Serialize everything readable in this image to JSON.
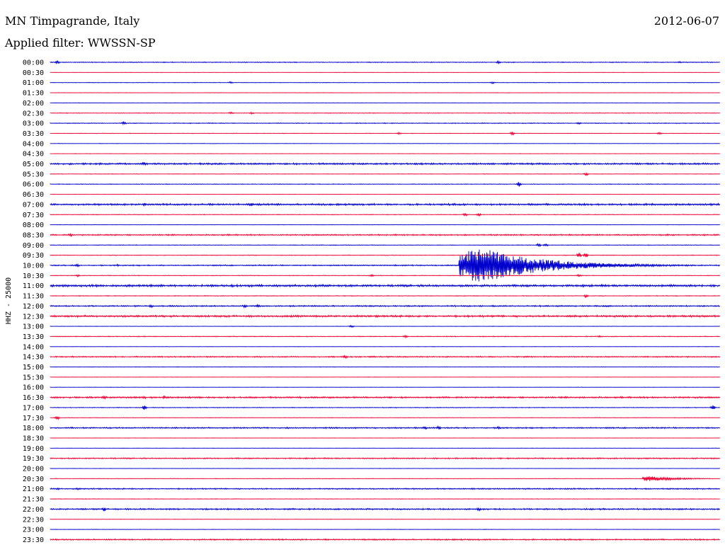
{
  "header": {
    "station": "MN Timpagrande, Italy",
    "filter": "Applied filter: WWSSN-SP",
    "date": "2012-06-07"
  },
  "chart_data": {
    "type": "line",
    "ylabel": "HHZ - 25000",
    "xlabel": "",
    "title": "",
    "trace_colors": [
      "#0000cc",
      "#ee0033"
    ],
    "series": [
      {
        "label": "00:00",
        "color": "#0000cc",
        "noise": 0.6,
        "spikes": [
          [
            0.01,
            2
          ],
          [
            0.67,
            2
          ],
          [
            0.94,
            1
          ]
        ]
      },
      {
        "label": "00:30",
        "color": "#ee0033",
        "noise": 0.3,
        "spikes": []
      },
      {
        "label": "01:00",
        "color": "#0000cc",
        "noise": 0.4,
        "spikes": [
          [
            0.27,
            1
          ],
          [
            0.66,
            1
          ]
        ]
      },
      {
        "label": "01:30",
        "color": "#ee0033",
        "noise": 0.3,
        "spikes": []
      },
      {
        "label": "02:00",
        "color": "#0000cc",
        "noise": 0.3,
        "spikes": []
      },
      {
        "label": "02:30",
        "color": "#ee0033",
        "noise": 0.5,
        "spikes": [
          [
            0.27,
            1
          ],
          [
            0.3,
            1
          ]
        ]
      },
      {
        "label": "03:00",
        "color": "#0000cc",
        "noise": 0.6,
        "spikes": [
          [
            0.11,
            2
          ],
          [
            0.79,
            1
          ]
        ]
      },
      {
        "label": "03:30",
        "color": "#ee0033",
        "noise": 0.4,
        "spikes": [
          [
            0.52,
            1
          ],
          [
            0.69,
            2
          ],
          [
            0.91,
            1
          ]
        ]
      },
      {
        "label": "04:00",
        "color": "#0000cc",
        "noise": 0.3,
        "spikes": []
      },
      {
        "label": "04:30",
        "color": "#ee0033",
        "noise": 0.3,
        "spikes": []
      },
      {
        "label": "05:00",
        "color": "#0000cc",
        "noise": 1.3,
        "spikes": [
          [
            0.14,
            2
          ]
        ]
      },
      {
        "label": "05:30",
        "color": "#ee0033",
        "noise": 0.4,
        "spikes": [
          [
            0.8,
            2
          ]
        ]
      },
      {
        "label": "06:00",
        "color": "#0000cc",
        "noise": 0.5,
        "spikes": [
          [
            0.7,
            3
          ]
        ]
      },
      {
        "label": "06:30",
        "color": "#ee0033",
        "noise": 0.3,
        "spikes": []
      },
      {
        "label": "07:00",
        "color": "#0000cc",
        "noise": 1.4,
        "spikes": [
          [
            0.14,
            2
          ],
          [
            0.3,
            2
          ]
        ]
      },
      {
        "label": "07:30",
        "color": "#ee0033",
        "noise": 0.5,
        "spikes": [
          [
            0.62,
            2
          ],
          [
            0.64,
            2
          ]
        ]
      },
      {
        "label": "08:00",
        "color": "#0000cc",
        "noise": 0.3,
        "spikes": []
      },
      {
        "label": "08:30",
        "color": "#ee0033",
        "noise": 1.0,
        "spikes": [
          [
            0.03,
            2
          ]
        ]
      },
      {
        "label": "09:00",
        "color": "#0000cc",
        "noise": 0.5,
        "spikes": [
          [
            0.73,
            2
          ],
          [
            0.74,
            2
          ]
        ]
      },
      {
        "label": "09:30",
        "color": "#ee0033",
        "noise": 0.5,
        "spikes": [
          [
            0.79,
            5
          ],
          [
            0.8,
            4
          ]
        ]
      },
      {
        "label": "10:00",
        "color": "#0000cc",
        "noise": 0.9,
        "spikes": [
          [
            0.04,
            2
          ],
          [
            0.1,
            1
          ],
          [
            0.75,
            1
          ]
        ],
        "event": {
          "start": 0.61,
          "peak": 0.03,
          "decay": 0.09,
          "amp": 26
        }
      },
      {
        "label": "10:30",
        "color": "#ee0033",
        "noise": 0.5,
        "spikes": [
          [
            0.04,
            1
          ],
          [
            0.48,
            1
          ],
          [
            0.79,
            1
          ]
        ]
      },
      {
        "label": "11:00",
        "color": "#0000cc",
        "noise": 1.6,
        "spikes": []
      },
      {
        "label": "11:30",
        "color": "#ee0033",
        "noise": 0.5,
        "spikes": [
          [
            0.8,
            2
          ]
        ]
      },
      {
        "label": "12:00",
        "color": "#0000cc",
        "noise": 1.0,
        "spikes": [
          [
            0.15,
            2
          ],
          [
            0.29,
            2
          ],
          [
            0.31,
            2
          ]
        ]
      },
      {
        "label": "12:30",
        "color": "#ee0033",
        "noise": 1.4,
        "spikes": []
      },
      {
        "label": "13:00",
        "color": "#0000cc",
        "noise": 0.3,
        "spikes": [
          [
            0.45,
            1
          ]
        ]
      },
      {
        "label": "13:30",
        "color": "#ee0033",
        "noise": 0.6,
        "spikes": [
          [
            0.53,
            1
          ],
          [
            0.82,
            1
          ]
        ]
      },
      {
        "label": "14:00",
        "color": "#0000cc",
        "noise": 0.3,
        "spikes": []
      },
      {
        "label": "14:30",
        "color": "#ee0033",
        "noise": 0.9,
        "spikes": [
          [
            0.44,
            2
          ]
        ]
      },
      {
        "label": "15:00",
        "color": "#0000cc",
        "noise": 0.4,
        "spikes": []
      },
      {
        "label": "15:30",
        "color": "#ee0033",
        "noise": 0.3,
        "spikes": []
      },
      {
        "label": "16:00",
        "color": "#0000cc",
        "noise": 0.3,
        "spikes": []
      },
      {
        "label": "16:30",
        "color": "#ee0033",
        "noise": 1.2,
        "spikes": [
          [
            0.08,
            2
          ],
          [
            0.14,
            2
          ],
          [
            0.17,
            2
          ]
        ]
      },
      {
        "label": "17:00",
        "color": "#0000cc",
        "noise": 0.5,
        "spikes": [
          [
            0.14,
            3
          ],
          [
            0.99,
            3
          ]
        ]
      },
      {
        "label": "17:30",
        "color": "#ee0033",
        "noise": 0.4,
        "spikes": [
          [
            0.01,
            2
          ]
        ]
      },
      {
        "label": "18:00",
        "color": "#0000cc",
        "noise": 1.0,
        "spikes": [
          [
            0.56,
            2
          ],
          [
            0.58,
            2
          ],
          [
            0.67,
            2
          ]
        ]
      },
      {
        "label": "18:30",
        "color": "#ee0033",
        "noise": 0.3,
        "spikes": []
      },
      {
        "label": "19:00",
        "color": "#0000cc",
        "noise": 0.3,
        "spikes": []
      },
      {
        "label": "19:30",
        "color": "#ee0033",
        "noise": 0.9,
        "spikes": []
      },
      {
        "label": "20:00",
        "color": "#0000cc",
        "noise": 0.3,
        "spikes": []
      },
      {
        "label": "20:30",
        "color": "#ee0033",
        "noise": 0.4,
        "spikes": [],
        "event": {
          "start": 0.885,
          "peak": 0.006,
          "decay": 0.04,
          "amp": 4
        }
      },
      {
        "label": "21:00",
        "color": "#0000cc",
        "noise": 0.9,
        "spikes": [
          [
            0.01,
            1
          ],
          [
            0.04,
            1
          ]
        ]
      },
      {
        "label": "21:30",
        "color": "#ee0033",
        "noise": 0.4,
        "spikes": []
      },
      {
        "label": "22:00",
        "color": "#0000cc",
        "noise": 1.1,
        "spikes": [
          [
            0.08,
            3
          ],
          [
            0.64,
            2
          ]
        ]
      },
      {
        "label": "22:30",
        "color": "#ee0033",
        "noise": 0.3,
        "spikes": []
      },
      {
        "label": "23:00",
        "color": "#0000cc",
        "noise": 0.3,
        "spikes": []
      },
      {
        "label": "23:30",
        "color": "#ee0033",
        "noise": 1.0,
        "spikes": []
      }
    ]
  }
}
